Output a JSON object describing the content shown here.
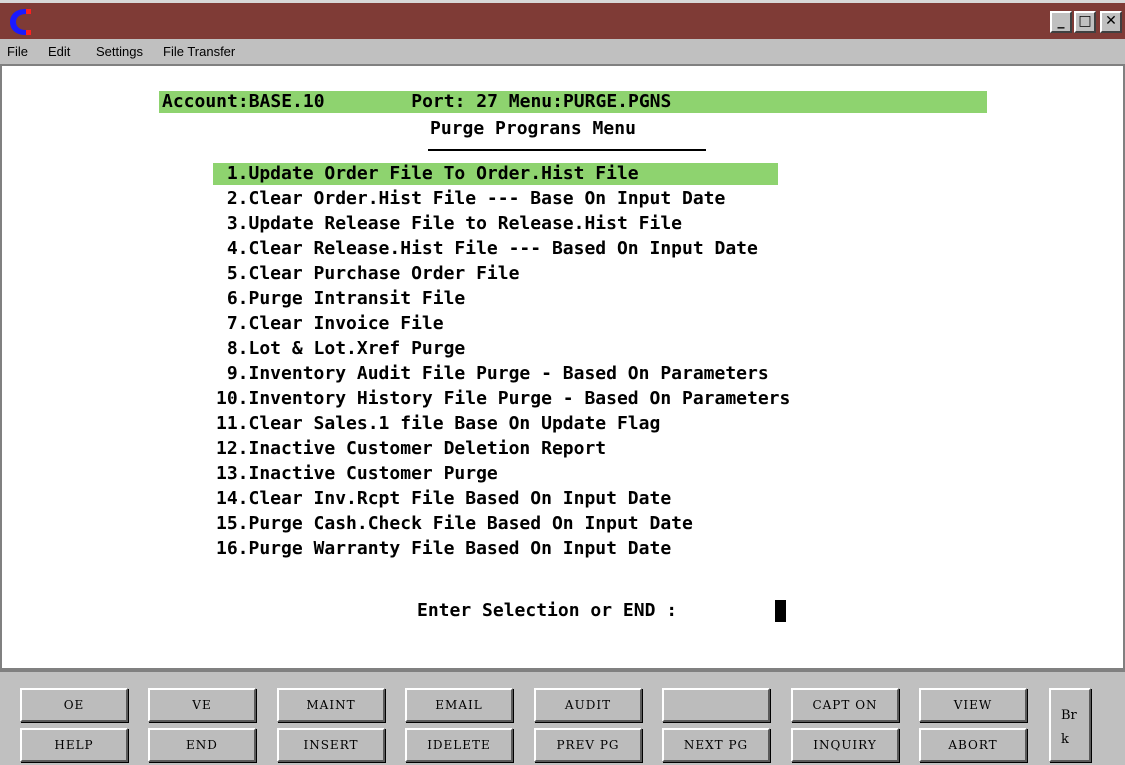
{
  "window": {
    "controls": {
      "minimize": "_",
      "maximize": "□",
      "close": "✕"
    },
    "title_bar_color": "#7f3b36"
  },
  "menubar": {
    "items": [
      "File",
      "Edit",
      "Settings",
      "File Transfer"
    ]
  },
  "terminal": {
    "status_line": "Account:BASE.10        Port: 27 Menu:PURGE.PGNS",
    "menu_title": "Purge Prograns Menu",
    "options": [
      " 1.Update Order File To Order.Hist File",
      " 2.Clear Order.Hist File --- Base On Input Date",
      " 3.Update Release File to Release.Hist File",
      " 4.Clear Release.Hist File --- Based On Input Date",
      " 5.Clear Purchase Order File",
      " 6.Purge Intransit File",
      " 7.Clear Invoice File",
      " 8.Lot & Lot.Xref Purge",
      " 9.Inventory Audit File Purge - Based On Parameters",
      "10.Inventory History File Purge - Based On Parameters",
      "11.Clear Sales.1 file Base On Update Flag",
      "12.Inactive Customer Deletion Report",
      "13.Inactive Customer Purge",
      "14.Clear Inv.Rcpt File Based On Input Date",
      "15.Purge Cash.Check File Based On Input Date",
      "16.Purge Warranty File Based On Input Date"
    ],
    "selected_index": 0,
    "prompt": "Enter Selection or END :",
    "highlight_color": "#8ed36f"
  },
  "function_keys": {
    "row1": [
      "OE",
      "VE",
      "MAINT",
      "EMAIL",
      "AUDIT",
      "",
      "CAPT ON",
      "VIEW"
    ],
    "row2": [
      "HELP",
      "END",
      "INSERT",
      "IDELETE",
      "PREV PG",
      "NEXT PG",
      "INQUIRY",
      "ABORT"
    ],
    "break_key": [
      "Br",
      "k"
    ]
  }
}
